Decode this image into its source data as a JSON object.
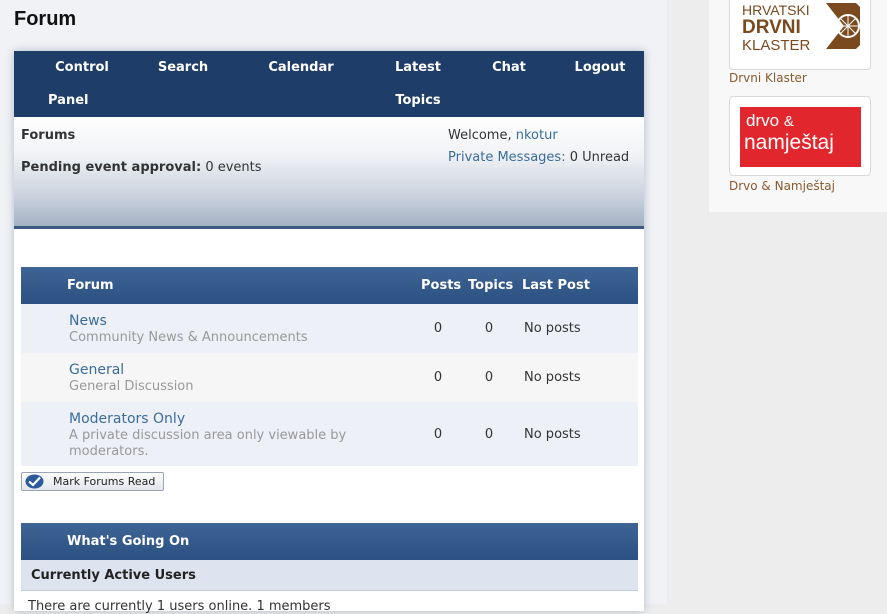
{
  "page": {
    "title": "Forum"
  },
  "nav": {
    "items": [
      {
        "label": "Control Panel",
        "line1": "Control",
        "line2": "Panel"
      },
      {
        "label": "Search"
      },
      {
        "label": "Calendar"
      },
      {
        "label": "Latest Topics",
        "line1": "Latest",
        "line2": "Topics"
      },
      {
        "label": "Chat"
      },
      {
        "label": "Logout"
      }
    ]
  },
  "header": {
    "forums_label": "Forums",
    "pending_label": "Pending event approval:",
    "pending_value": "0 events",
    "welcome_prefix": "Welcome,",
    "username": "nkotur",
    "pm_label": "Private Messages:",
    "pm_value": "0 Unread"
  },
  "table": {
    "columns": [
      "Forum",
      "Posts",
      "Topics",
      "Last Post"
    ],
    "rows": [
      {
        "name": "News",
        "description": "Community News & Announcements",
        "posts": "0",
        "topics": "0",
        "last_post": "No posts"
      },
      {
        "name": "General",
        "description": "General Discussion",
        "posts": "0",
        "topics": "0",
        "last_post": "No posts"
      },
      {
        "name": "Moderators Only",
        "description": "A private discussion area only viewable by moderators.",
        "posts": "0",
        "topics": "0",
        "last_post": "No posts"
      }
    ]
  },
  "mark_read_label": "Mark Forums Read",
  "whats_going_on": {
    "title": "What's Going On",
    "active_users_title": "Currently Active Users",
    "active_users_text": "There are currently 1 users online. 1 members"
  },
  "sidebar": {
    "sponsors": [
      {
        "caption": "Drvni Klaster",
        "logo_lines": [
          "HRVATSKI",
          "DRVNI",
          "KLASTER"
        ]
      },
      {
        "caption": "Drvo & Namještaj",
        "logo_text_a": "drvo",
        "logo_amp": "&",
        "logo_text_b": "namještaj"
      }
    ]
  },
  "colors": {
    "nav_bg": "#1f3d69",
    "header_blue": "#2b5082",
    "link": "#3a6d99",
    "logo_red": "#e1262d",
    "logo_brown": "#7a4a1e"
  }
}
